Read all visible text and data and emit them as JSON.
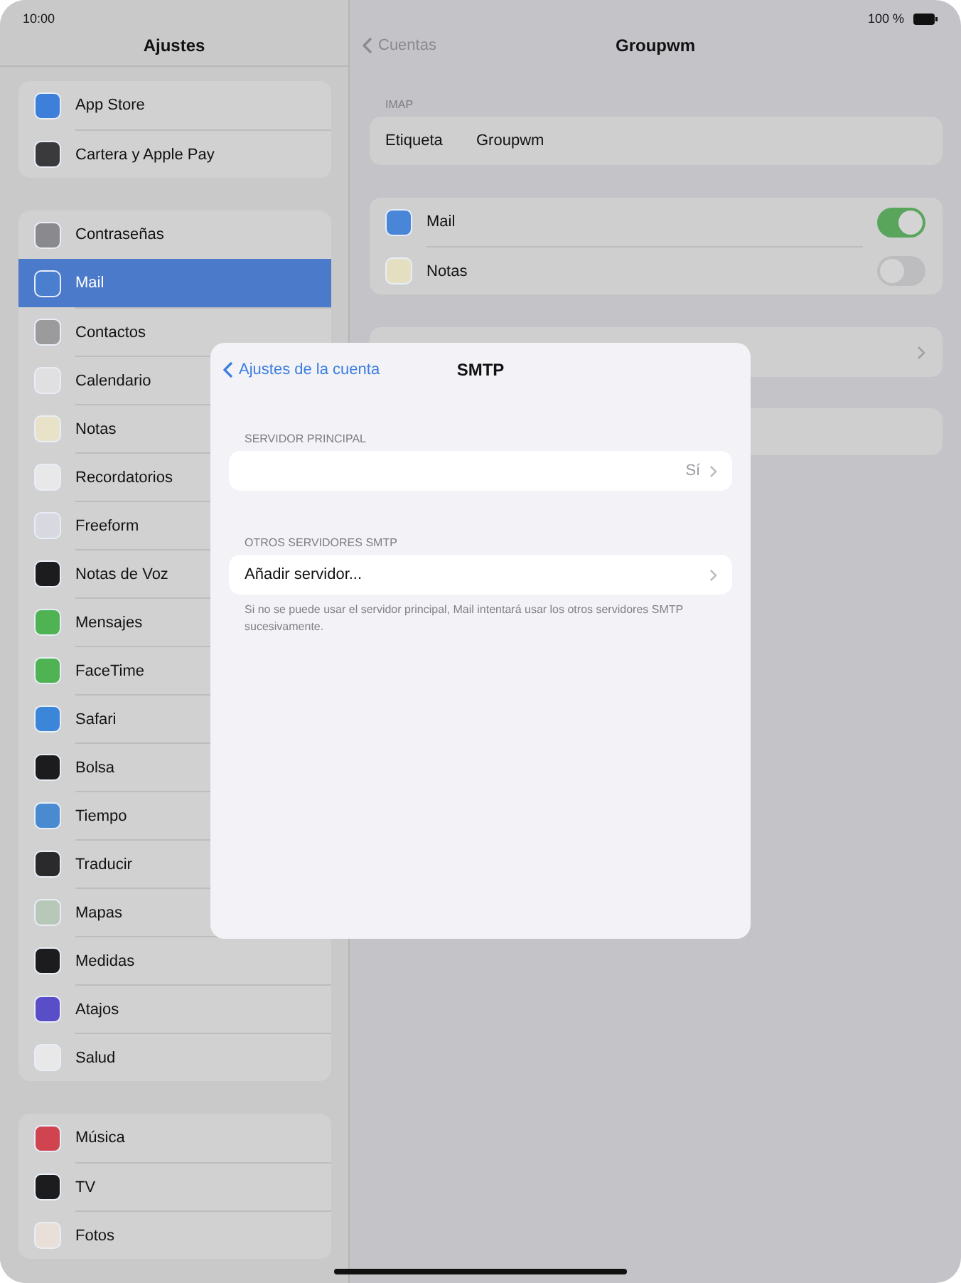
{
  "status_bar": {
    "time": "10:00",
    "battery": "100 %"
  },
  "sidebar": {
    "title": "Ajustes",
    "groups": [
      {
        "items": [
          {
            "label": "App Store",
            "selected": false
          },
          {
            "label": "Cartera y Apple Pay",
            "selected": false
          }
        ]
      },
      {
        "items": [
          {
            "label": "Contraseñas",
            "selected": false
          },
          {
            "label": "Mail",
            "selected": true
          },
          {
            "label": "Contactos",
            "selected": false
          },
          {
            "label": "Calendario",
            "selected": false
          },
          {
            "label": "Notas",
            "selected": false
          },
          {
            "label": "Recordatorios",
            "selected": false
          },
          {
            "label": "Freeform",
            "selected": false
          },
          {
            "label": "Notas de Voz",
            "selected": false
          },
          {
            "label": "Mensajes",
            "selected": false
          },
          {
            "label": "FaceTime",
            "selected": false
          },
          {
            "label": "Safari",
            "selected": false
          },
          {
            "label": "Bolsa",
            "selected": false
          },
          {
            "label": "Tiempo",
            "selected": false
          },
          {
            "label": "Traducir",
            "selected": false
          },
          {
            "label": "Mapas",
            "selected": false
          },
          {
            "label": "Medidas",
            "selected": false
          },
          {
            "label": "Atajos",
            "selected": false
          },
          {
            "label": "Salud",
            "selected": false
          }
        ]
      },
      {
        "items": [
          {
            "label": "Música",
            "selected": false
          },
          {
            "label": "TV",
            "selected": false
          },
          {
            "label": "Fotos",
            "selected": false
          }
        ]
      }
    ]
  },
  "detail": {
    "back": "Cuentas",
    "title": "Groupwm",
    "section_label": "IMAP",
    "label_row": {
      "label": "Etiqueta",
      "value": "Groupwm"
    },
    "toggles": [
      {
        "label": "Mail",
        "on": true
      },
      {
        "label": "Notas",
        "on": false
      }
    ]
  },
  "dialog": {
    "back": "Ajustes de la cuenta",
    "title": "SMTP",
    "sections": [
      {
        "header": "SERVIDOR PRINCIPAL",
        "rows": [
          {
            "label": "",
            "value": "Sí"
          }
        ]
      },
      {
        "header": "OTROS SERVIDORES SMTP",
        "rows": [
          {
            "label": "Añadir servidor...",
            "value": ""
          }
        ],
        "footer": "Si no se puede usar el servidor principal, Mail intentará usar los otros servidores SMTP sucesivamente."
      }
    ]
  }
}
